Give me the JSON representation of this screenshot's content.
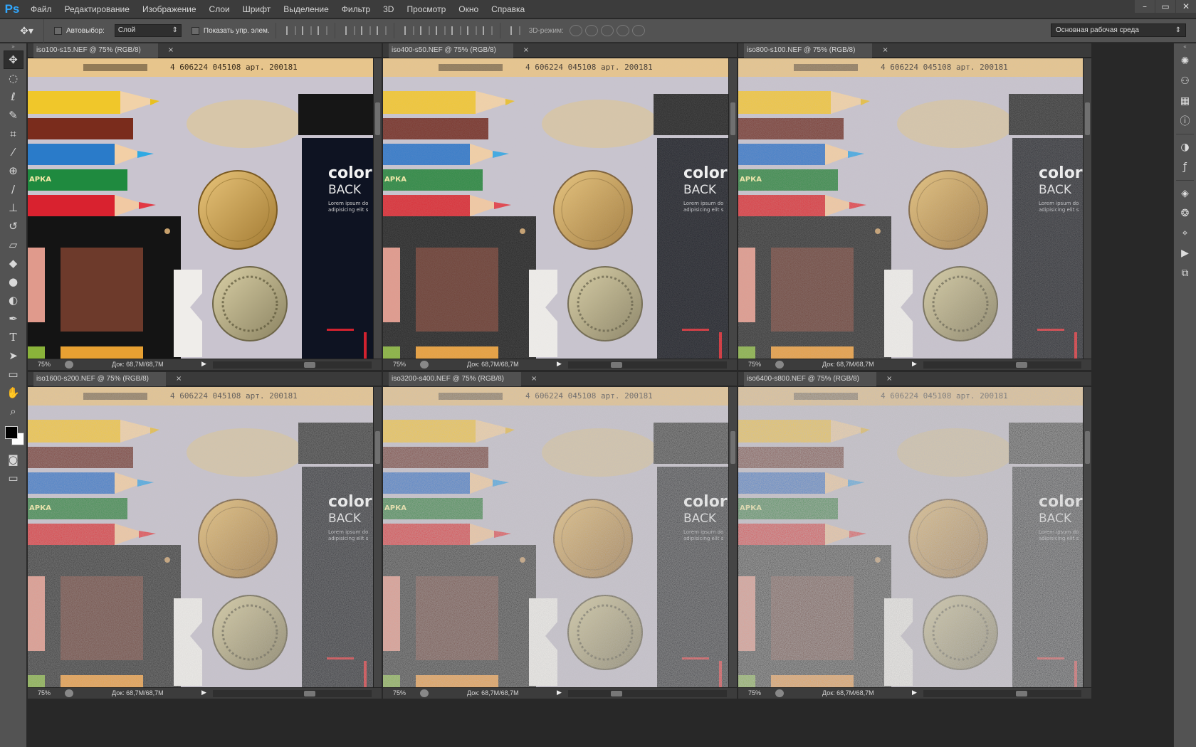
{
  "app": {
    "logo": "Ps",
    "menu": [
      "Файл",
      "Редактирование",
      "Изображение",
      "Слои",
      "Шрифт",
      "Выделение",
      "Фильтр",
      "3D",
      "Просмотр",
      "Окно",
      "Справка"
    ],
    "window_controls": [
      "–",
      "▭",
      "✕"
    ]
  },
  "options": {
    "autoselect_label": "Автовыбор:",
    "autoselect_value": "Слой",
    "show_controls_label": "Показать упр. элем.",
    "mode3d_label": "3D-режим:",
    "workspace": "Основная рабочая среда"
  },
  "tools": [
    "move-icon",
    "marquee-icon",
    "lasso-icon",
    "quick-select-icon",
    "crop-icon",
    "eyedropper-icon",
    "healing-icon",
    "brush-icon",
    "stamp-icon",
    "history-brush-icon",
    "eraser-icon",
    "paint-bucket-icon",
    "blur-icon",
    "dodge-icon",
    "pen-icon",
    "type-icon",
    "path-select-icon",
    "rectangle-icon",
    "hand-icon",
    "zoom-icon"
  ],
  "dock_icons": [
    "brush-preset-icon",
    "clone-source-icon",
    "grid-icon",
    "info-icon",
    "adjustments-icon",
    "fx-icon",
    "layers-icon",
    "channels-icon",
    "paths-icon",
    "actions-icon",
    "history-icon"
  ],
  "documents": [
    {
      "title": "iso100-s15.NEF @ 75% (RGB/8)",
      "zoom": "75%",
      "doc_size": "Док: 68,7M/68,7M",
      "noise": 0
    },
    {
      "title": "iso400-s50.NEF @ 75% (RGB/8)",
      "zoom": "75%",
      "doc_size": "Док: 68,7M/68,7M",
      "noise": 0.05
    },
    {
      "title": "iso800-s100.NEF @ 75% (RGB/8)",
      "zoom": "75%",
      "doc_size": "Док: 68,7M/68,7M",
      "noise": 0.1
    },
    {
      "title": "iso1600-s200.NEF @ 75% (RGB/8)",
      "zoom": "75%",
      "doc_size": "Док: 68,7M/68,7M",
      "noise": 0.15
    },
    {
      "title": "iso3200-s400.NEF @ 75% (RGB/8)",
      "zoom": "75%",
      "doc_size": "Док: 68,7M/68,7M",
      "noise": 0.22
    },
    {
      "title": "iso6400-s800.NEF @ 75% (RGB/8)",
      "zoom": "75%",
      "doc_size": "Док: 68,7M/68,7M",
      "noise": 0.3
    }
  ],
  "photo_text": {
    "barcode": "4 606224 045108 арт. 200181",
    "pencil_brand": "АРКА",
    "card_title": "color",
    "card_sub": "BACK",
    "card_lorem": "Lorem ipsum do",
    "card_lorem2": "adipisicing elit s"
  },
  "colors": {
    "accent": "#31a8ff",
    "panel": "#535353",
    "dark": "#282828"
  }
}
